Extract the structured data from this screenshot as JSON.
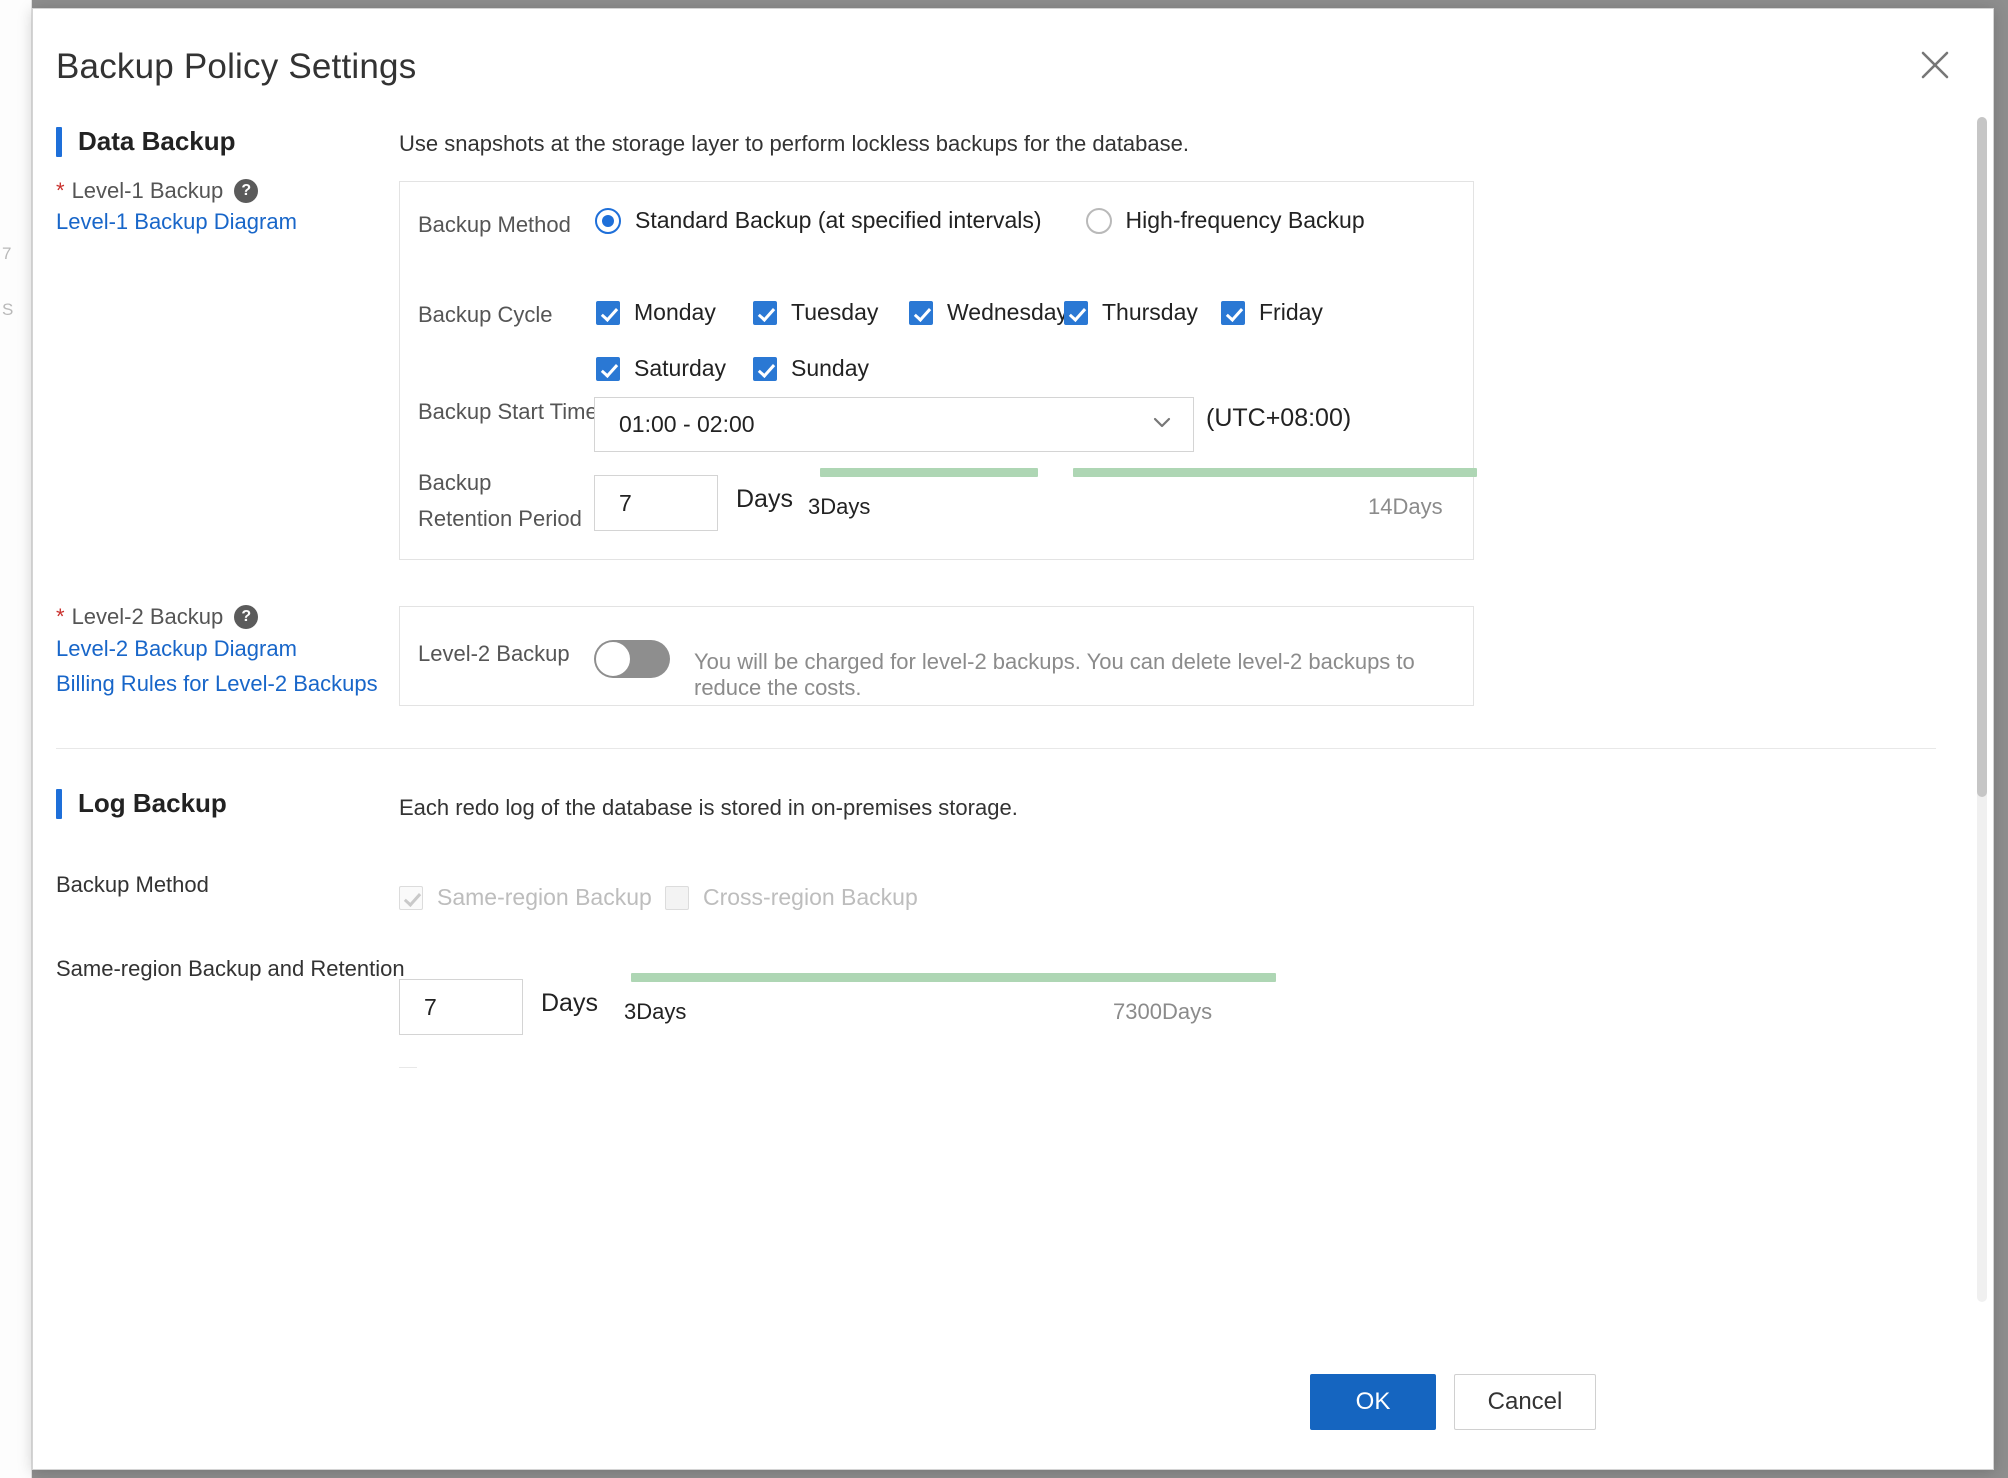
{
  "dialog": {
    "title": "Backup Policy Settings",
    "close_icon": "close-icon"
  },
  "behind_page": {
    "line1": "7",
    "line2": "S"
  },
  "data_backup": {
    "section_title": "Data Backup",
    "lead_text": "Use snapshots at the storage layer to perform lockless backups for the database.",
    "level1": {
      "label": "Level-1 Backup",
      "required_mark": "*",
      "help_icon": "question-mark-icon",
      "link": "Level-1 Backup Diagram"
    },
    "backup_method": {
      "label": "Backup Method",
      "options": [
        {
          "label": "Standard Backup (at specified intervals)",
          "checked": true
        },
        {
          "label": "High-frequency Backup",
          "checked": false
        }
      ]
    },
    "backup_cycle": {
      "label": "Backup Cycle",
      "days": [
        {
          "label": "Monday",
          "checked": true
        },
        {
          "label": "Tuesday",
          "checked": true
        },
        {
          "label": "Wednesday",
          "checked": true
        },
        {
          "label": "Thursday",
          "checked": true
        },
        {
          "label": "Friday",
          "checked": true
        },
        {
          "label": "Saturday",
          "checked": true
        },
        {
          "label": "Sunday",
          "checked": true
        }
      ]
    },
    "backup_start_time": {
      "label": "Backup Start Time",
      "value": "01:00 - 02:00",
      "timezone": "(UTC+08:00)",
      "chevron_icon": "chevron-down-icon"
    },
    "retention": {
      "label": "Backup Retention Period",
      "value": "7",
      "unit": "Days",
      "slider_min_label": "3Days",
      "slider_max_label": "14Days"
    },
    "level2": {
      "label": "Level-2 Backup",
      "required_mark": "*",
      "help_icon": "question-mark-icon",
      "link_diagram": "Level-2 Backup Diagram",
      "link_billing": "Billing Rules for Level-2 Backups",
      "panel_label": "Level-2 Backup",
      "toggle_on": false,
      "note": "You will be charged for level-2 backups. You can delete level-2 backups to reduce the costs."
    }
  },
  "log_backup": {
    "section_title": "Log Backup",
    "lead_text": "Each redo log of the database is stored in on-premises storage.",
    "backup_method": {
      "label": "Backup Method",
      "options": [
        {
          "label": "Same-region Backup",
          "checked": true,
          "disabled": true
        },
        {
          "label": "Cross-region Backup",
          "checked": false,
          "disabled": true
        }
      ]
    },
    "same_region_retention": {
      "label": "Same-region Backup and Retention",
      "value": "7",
      "unit": "Days",
      "slider_min_label": "3Days",
      "slider_max_label": "7300Days"
    }
  },
  "footer": {
    "ok_label": "OK",
    "cancel_label": "Cancel"
  },
  "colors": {
    "accent": "#1e6fd9",
    "primary_button": "#1565c0",
    "link": "#1866c9",
    "slider_track": "#aed6b4",
    "required": "#c9302c"
  }
}
